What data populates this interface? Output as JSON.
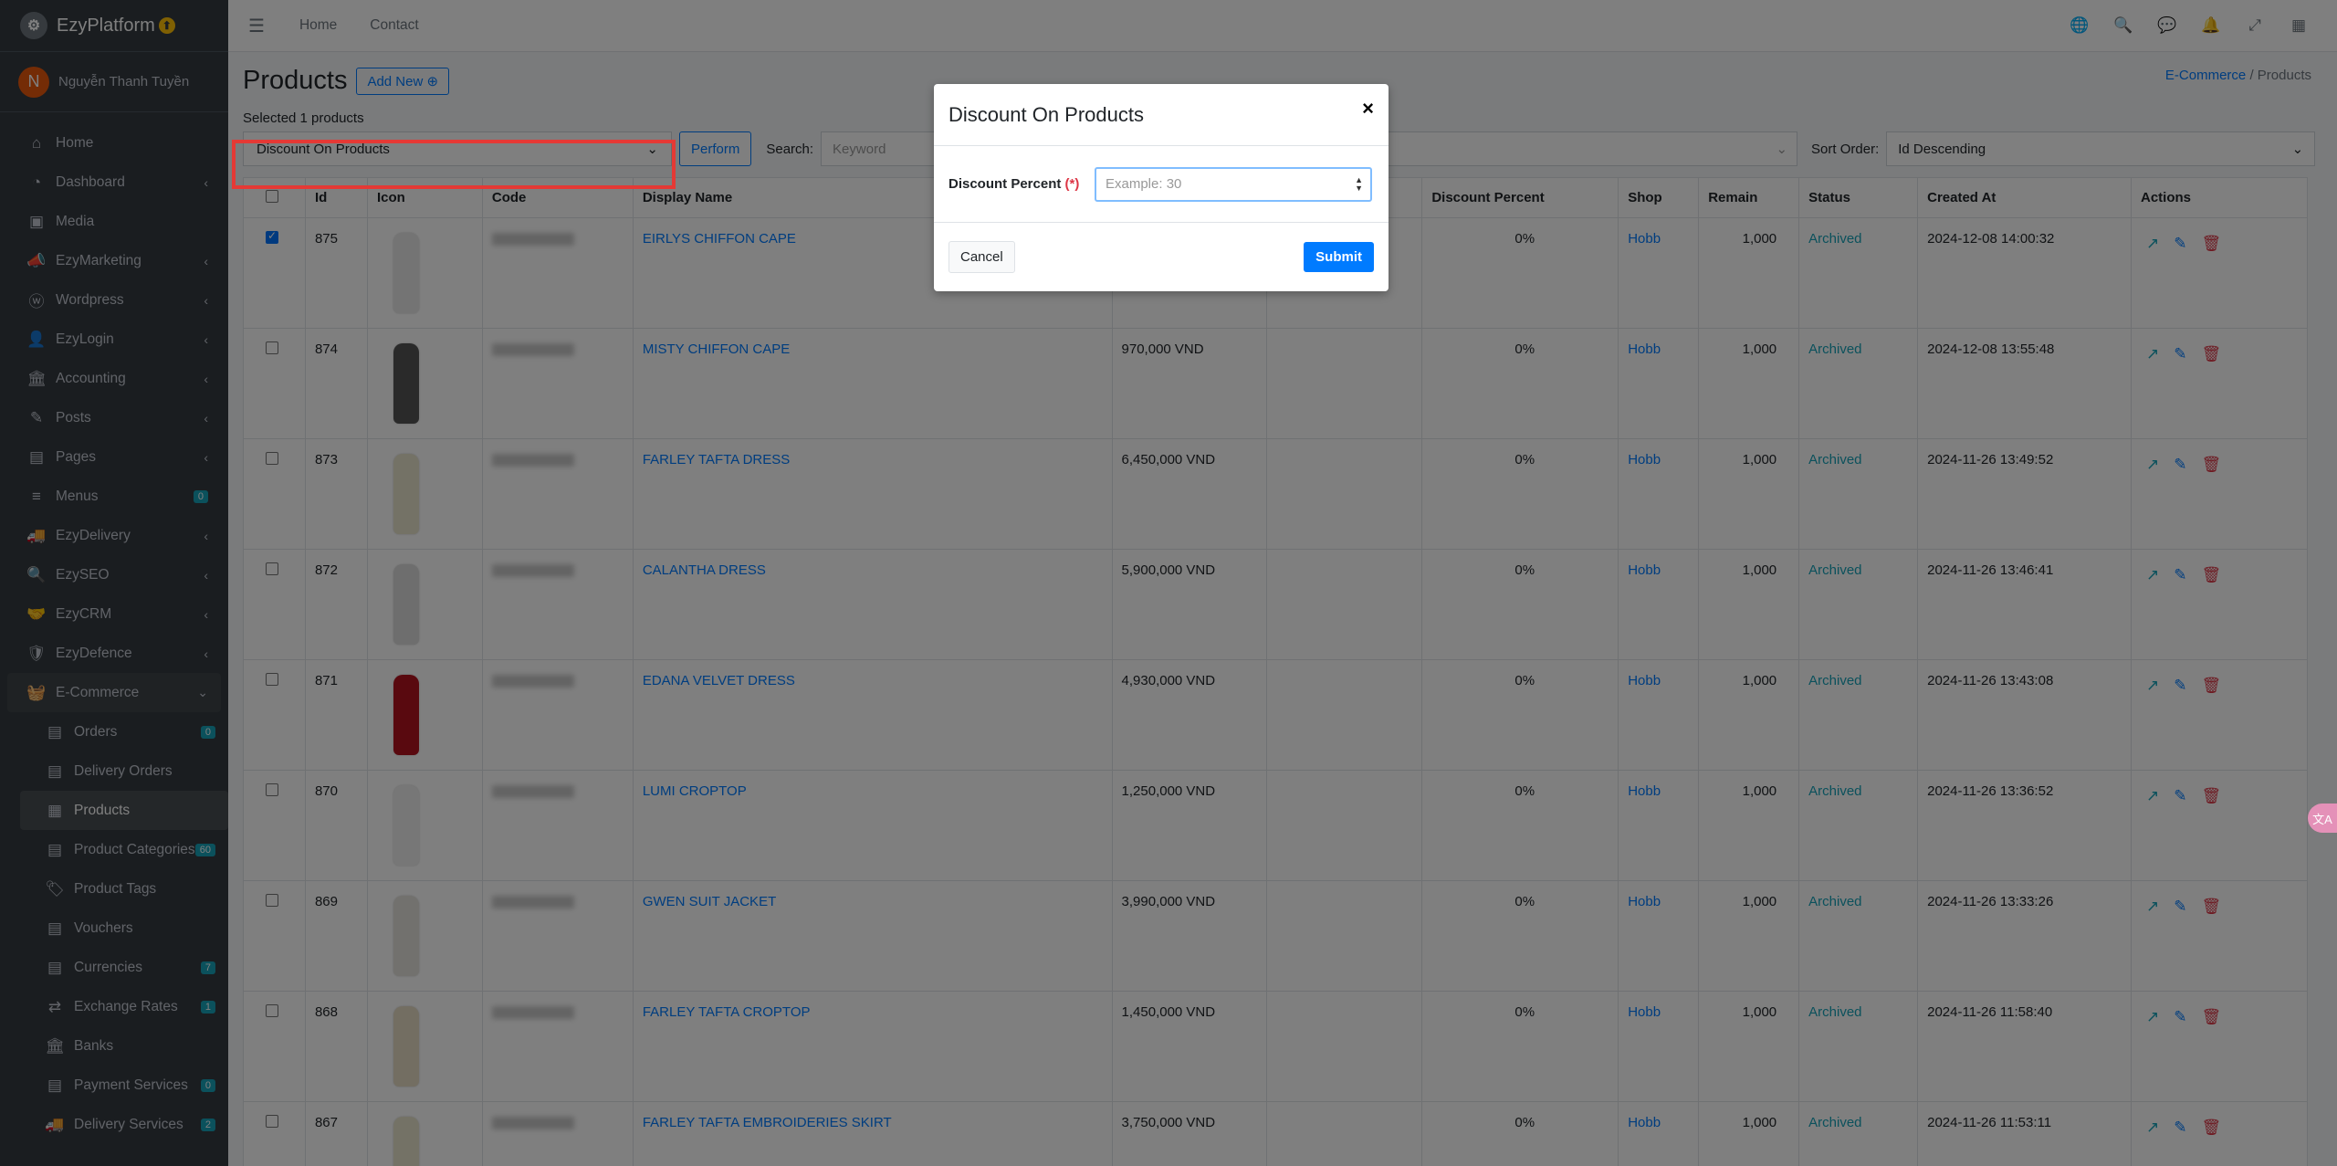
{
  "brand": {
    "name": "EzyPlatform",
    "badge": "⬆"
  },
  "user": {
    "initial": "N",
    "name": "Nguyễn Thanh Tuyền"
  },
  "sidebar": {
    "items": [
      {
        "label": "Home",
        "icon": "home-icon",
        "glyph": "⌂"
      },
      {
        "label": "Dashboard",
        "icon": "dashboard-icon",
        "glyph": "◔",
        "arrow": "‹"
      },
      {
        "label": "Media",
        "icon": "image-icon",
        "glyph": "▣"
      },
      {
        "label": "EzyMarketing",
        "icon": "megaphone-icon",
        "glyph": "📣",
        "arrow": "‹"
      },
      {
        "label": "Wordpress",
        "icon": "wordpress-icon",
        "glyph": "ⓦ",
        "arrow": "‹"
      },
      {
        "label": "EzyLogin",
        "icon": "user-lock-icon",
        "glyph": "👤",
        "arrow": "‹"
      },
      {
        "label": "Accounting",
        "icon": "bank-icon",
        "glyph": "🏛",
        "arrow": "‹"
      },
      {
        "label": "Posts",
        "icon": "pen-icon",
        "glyph": "✎",
        "arrow": "‹"
      },
      {
        "label": "Pages",
        "icon": "pages-icon",
        "glyph": "▤",
        "arrow": "‹"
      },
      {
        "label": "Menus",
        "icon": "menu-icon",
        "glyph": "≡",
        "badge": "0"
      },
      {
        "label": "EzyDelivery",
        "icon": "truck-icon",
        "glyph": "🚚",
        "arrow": "‹"
      },
      {
        "label": "EzySEO",
        "icon": "search-icon",
        "glyph": "🔍",
        "arrow": "‹"
      },
      {
        "label": "EzyCRM",
        "icon": "handshake-icon",
        "glyph": "🤝",
        "arrow": "‹"
      },
      {
        "label": "EzyDefence",
        "icon": "shield-icon",
        "glyph": "🛡",
        "arrow": "‹"
      },
      {
        "label": "E-Commerce",
        "icon": "basket-icon",
        "glyph": "🧺",
        "arrow": "⌄"
      }
    ],
    "sub_items": [
      {
        "label": "Orders",
        "icon": "file-icon",
        "glyph": "▤",
        "badge": "0"
      },
      {
        "label": "Delivery Orders",
        "icon": "delivery-icon",
        "glyph": "▤"
      },
      {
        "label": "Products",
        "icon": "products-icon",
        "glyph": "▦",
        "active": true
      },
      {
        "label": "Product Categories",
        "icon": "categories-icon",
        "glyph": "▤",
        "badge": "60"
      },
      {
        "label": "Product Tags",
        "icon": "tags-icon",
        "glyph": "🏷"
      },
      {
        "label": "Vouchers",
        "icon": "voucher-icon",
        "glyph": "▤"
      },
      {
        "label": "Currencies",
        "icon": "currency-icon",
        "glyph": "▤",
        "badge": "7"
      },
      {
        "label": "Exchange Rates",
        "icon": "exchange-icon",
        "glyph": "⇄",
        "badge": "1"
      },
      {
        "label": "Banks",
        "icon": "bank-icon",
        "glyph": "🏛"
      },
      {
        "label": "Payment Services",
        "icon": "payment-icon",
        "glyph": "▤",
        "badge": "0"
      },
      {
        "label": "Delivery Services",
        "icon": "truck-icon",
        "glyph": "🚚",
        "badge": "2"
      }
    ]
  },
  "topbar": {
    "home": "Home",
    "contact": "Contact"
  },
  "page": {
    "title": "Products",
    "add_new": "Add New",
    "breadcrumb_parent": "E-Commerce",
    "breadcrumb_sep": "/",
    "breadcrumb_current": "Products",
    "selected_text": "Selected 1 products",
    "bulk_action": "Discount On Products",
    "perform": "Perform",
    "search_label": "Search:",
    "search_placeholder": "Keyword",
    "sort_label": "Sort Order:",
    "sort_value": "Id Descending"
  },
  "table": {
    "headers": [
      "",
      "Id",
      "Icon",
      "Code",
      "Display Name",
      "",
      "",
      "Discount Percent",
      "Shop",
      "Remain",
      "Status",
      "Created At",
      "Actions"
    ],
    "rows": [
      {
        "checked": true,
        "id": "875",
        "name": "EIRLYS CHIFFON CAPE",
        "price": "",
        "discount": "0%",
        "shop": "Hobb",
        "remain": "1,000",
        "status": "Archived",
        "created": "2024-12-08 14:00:32",
        "color": "#e8e8e8"
      },
      {
        "checked": false,
        "id": "874",
        "name": "MISTY CHIFFON CAPE",
        "price": "970,000 VND",
        "discount": "0%",
        "shop": "Hobb",
        "remain": "1,000",
        "status": "Archived",
        "created": "2024-12-08 13:55:48",
        "color": "#555555"
      },
      {
        "checked": false,
        "id": "873",
        "name": "FARLEY TAFTA DRESS",
        "price": "6,450,000 VND",
        "discount": "0%",
        "shop": "Hobb",
        "remain": "1,000",
        "status": "Archived",
        "created": "2024-11-26 13:49:52",
        "color": "#e9e4cc"
      },
      {
        "checked": false,
        "id": "872",
        "name": "CALANTHA DRESS",
        "price": "5,900,000 VND",
        "discount": "0%",
        "shop": "Hobb",
        "remain": "1,000",
        "status": "Archived",
        "created": "2024-11-26 13:46:41",
        "color": "#dcdcdc"
      },
      {
        "checked": false,
        "id": "871",
        "name": "EDANA VELVET DRESS",
        "price": "4,930,000 VND",
        "discount": "0%",
        "shop": "Hobb",
        "remain": "1,000",
        "status": "Archived",
        "created": "2024-11-26 13:43:08",
        "color": "#b3121f"
      },
      {
        "checked": false,
        "id": "870",
        "name": "LUMI CROPTOP",
        "price": "1,250,000 VND",
        "discount": "0%",
        "shop": "Hobb",
        "remain": "1,000",
        "status": "Archived",
        "created": "2024-11-26 13:36:52",
        "color": "#efefef"
      },
      {
        "checked": false,
        "id": "869",
        "name": "GWEN SUIT JACKET",
        "price": "3,990,000 VND",
        "discount": "0%",
        "shop": "Hobb",
        "remain": "1,000",
        "status": "Archived",
        "created": "2024-11-26 13:33:26",
        "color": "#e4e2dc"
      },
      {
        "checked": false,
        "id": "868",
        "name": "FARLEY TAFTA CROPTOP",
        "price": "1,450,000 VND",
        "discount": "0%",
        "shop": "Hobb",
        "remain": "1,000",
        "status": "Archived",
        "created": "2024-11-26 11:58:40",
        "color": "#e6dcc4"
      },
      {
        "checked": false,
        "id": "867",
        "name": "FARLEY TAFTA EMBROIDERIES SKIRT",
        "price": "3,750,000 VND",
        "discount": "0%",
        "shop": "Hobb",
        "remain": "1,000",
        "status": "Archived",
        "created": "2024-11-26 11:53:11",
        "color": "#e9e4cc"
      }
    ]
  },
  "modal": {
    "title": "Discount On Products",
    "close": "×",
    "field_label": "Discount Percent",
    "required_mark": "(*)",
    "placeholder": "Example: 30",
    "cancel": "Cancel",
    "submit": "Submit"
  },
  "fab": {
    "label": "文A"
  }
}
